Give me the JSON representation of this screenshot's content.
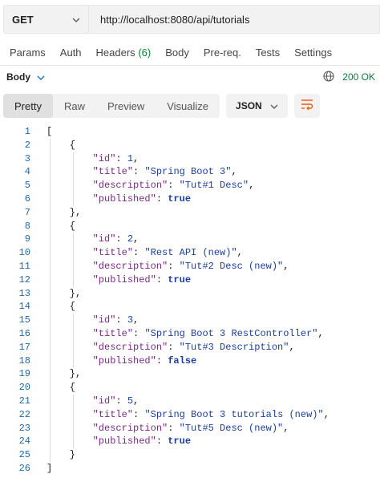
{
  "request": {
    "method": "GET",
    "url": "http://localhost:8080/api/tutorials"
  },
  "tabs": [
    {
      "label": "Params"
    },
    {
      "label": "Auth"
    },
    {
      "label": "Headers",
      "count": "(6)"
    },
    {
      "label": "Body"
    },
    {
      "label": "Pre-req."
    },
    {
      "label": "Tests"
    },
    {
      "label": "Settings"
    }
  ],
  "response": {
    "section_label": "Body",
    "status": "200 OK"
  },
  "view_modes": [
    "Pretty",
    "Raw",
    "Preview",
    "Visualize"
  ],
  "active_view": "Pretty",
  "format": "JSON",
  "json_lines": [
    [
      {
        "t": "brk",
        "v": "["
      }
    ],
    [
      {
        "t": "pun",
        "v": "    {"
      }
    ],
    [
      {
        "t": "pun",
        "v": "        "
      },
      {
        "t": "key",
        "v": "\"id\""
      },
      {
        "t": "pun",
        "v": ": "
      },
      {
        "t": "num",
        "v": "1"
      },
      {
        "t": "pun",
        "v": ","
      }
    ],
    [
      {
        "t": "pun",
        "v": "        "
      },
      {
        "t": "key",
        "v": "\"title\""
      },
      {
        "t": "pun",
        "v": ": "
      },
      {
        "t": "str",
        "v": "\"Spring Boot 3\""
      },
      {
        "t": "pun",
        "v": ","
      }
    ],
    [
      {
        "t": "pun",
        "v": "        "
      },
      {
        "t": "key",
        "v": "\"description\""
      },
      {
        "t": "pun",
        "v": ": "
      },
      {
        "t": "str",
        "v": "\"Tut#1 Desc\""
      },
      {
        "t": "pun",
        "v": ","
      }
    ],
    [
      {
        "t": "pun",
        "v": "        "
      },
      {
        "t": "key",
        "v": "\"published\""
      },
      {
        "t": "pun",
        "v": ": "
      },
      {
        "t": "kw",
        "v": "true"
      }
    ],
    [
      {
        "t": "pun",
        "v": "    },"
      }
    ],
    [
      {
        "t": "pun",
        "v": "    {"
      }
    ],
    [
      {
        "t": "pun",
        "v": "        "
      },
      {
        "t": "key",
        "v": "\"id\""
      },
      {
        "t": "pun",
        "v": ": "
      },
      {
        "t": "num",
        "v": "2"
      },
      {
        "t": "pun",
        "v": ","
      }
    ],
    [
      {
        "t": "pun",
        "v": "        "
      },
      {
        "t": "key",
        "v": "\"title\""
      },
      {
        "t": "pun",
        "v": ": "
      },
      {
        "t": "str",
        "v": "\"Rest API (new)\""
      },
      {
        "t": "pun",
        "v": ","
      }
    ],
    [
      {
        "t": "pun",
        "v": "        "
      },
      {
        "t": "key",
        "v": "\"description\""
      },
      {
        "t": "pun",
        "v": ": "
      },
      {
        "t": "str",
        "v": "\"Tut#2 Desc (new)\""
      },
      {
        "t": "pun",
        "v": ","
      }
    ],
    [
      {
        "t": "pun",
        "v": "        "
      },
      {
        "t": "key",
        "v": "\"published\""
      },
      {
        "t": "pun",
        "v": ": "
      },
      {
        "t": "kw",
        "v": "true"
      }
    ],
    [
      {
        "t": "pun",
        "v": "    },"
      }
    ],
    [
      {
        "t": "pun",
        "v": "    {"
      }
    ],
    [
      {
        "t": "pun",
        "v": "        "
      },
      {
        "t": "key",
        "v": "\"id\""
      },
      {
        "t": "pun",
        "v": ": "
      },
      {
        "t": "num",
        "v": "3"
      },
      {
        "t": "pun",
        "v": ","
      }
    ],
    [
      {
        "t": "pun",
        "v": "        "
      },
      {
        "t": "key",
        "v": "\"title\""
      },
      {
        "t": "pun",
        "v": ": "
      },
      {
        "t": "str",
        "v": "\"Spring Boot 3 RestController\""
      },
      {
        "t": "pun",
        "v": ","
      }
    ],
    [
      {
        "t": "pun",
        "v": "        "
      },
      {
        "t": "key",
        "v": "\"description\""
      },
      {
        "t": "pun",
        "v": ": "
      },
      {
        "t": "str",
        "v": "\"Tut#3 Description\""
      },
      {
        "t": "pun",
        "v": ","
      }
    ],
    [
      {
        "t": "pun",
        "v": "        "
      },
      {
        "t": "key",
        "v": "\"published\""
      },
      {
        "t": "pun",
        "v": ": "
      },
      {
        "t": "kw",
        "v": "false"
      }
    ],
    [
      {
        "t": "pun",
        "v": "    },"
      }
    ],
    [
      {
        "t": "pun",
        "v": "    {"
      }
    ],
    [
      {
        "t": "pun",
        "v": "        "
      },
      {
        "t": "key",
        "v": "\"id\""
      },
      {
        "t": "pun",
        "v": ": "
      },
      {
        "t": "num",
        "v": "5"
      },
      {
        "t": "pun",
        "v": ","
      }
    ],
    [
      {
        "t": "pun",
        "v": "        "
      },
      {
        "t": "key",
        "v": "\"title\""
      },
      {
        "t": "pun",
        "v": ": "
      },
      {
        "t": "str",
        "v": "\"Spring Boot 3 tutorials (new)\""
      },
      {
        "t": "pun",
        "v": ","
      }
    ],
    [
      {
        "t": "pun",
        "v": "        "
      },
      {
        "t": "key",
        "v": "\"description\""
      },
      {
        "t": "pun",
        "v": ": "
      },
      {
        "t": "str",
        "v": "\"Tut#5 Desc (new)\""
      },
      {
        "t": "pun",
        "v": ","
      }
    ],
    [
      {
        "t": "pun",
        "v": "        "
      },
      {
        "t": "key",
        "v": "\"published\""
      },
      {
        "t": "pun",
        "v": ": "
      },
      {
        "t": "kw",
        "v": "true"
      }
    ],
    [
      {
        "t": "pun",
        "v": "    }"
      }
    ],
    [
      {
        "t": "brk",
        "v": "]"
      }
    ]
  ],
  "colors": {
    "status_ok": "#0a7a3a",
    "json_key": "#7b2a87",
    "json_value": "#1a3f9e",
    "line_number": "#2468a4",
    "wrap_icon": "#e8590c"
  },
  "icons": {
    "method_dropdown": "chevron-down-icon",
    "body_dropdown": "chevron-down-icon",
    "network": "globe-icon",
    "format_dropdown": "chevron-down-icon",
    "wrap": "wrap-lines-icon"
  }
}
